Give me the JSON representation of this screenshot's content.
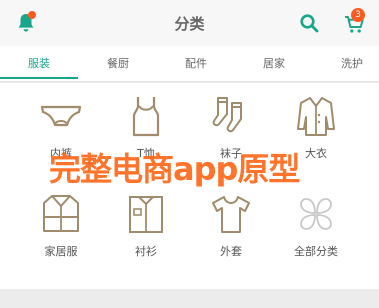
{
  "header": {
    "title": "分类",
    "cart_count": "3",
    "icons": {
      "notify": "bell-icon",
      "search": "search-icon",
      "cart": "cart-icon"
    },
    "colors": {
      "accent": "#1aa68a",
      "badge": "#ff5a1f"
    }
  },
  "tabs": [
    {
      "label": "服装",
      "active": true
    },
    {
      "label": "餐厨",
      "active": false
    },
    {
      "label": "配件",
      "active": false
    },
    {
      "label": "居家",
      "active": false
    },
    {
      "label": "洗护",
      "active": false
    }
  ],
  "categories": [
    {
      "label": "内裤",
      "icon": "underwear-icon"
    },
    {
      "label": "T恤",
      "icon": "tank-top-icon"
    },
    {
      "label": "袜子",
      "icon": "socks-icon"
    },
    {
      "label": "大衣",
      "icon": "coat-icon"
    },
    {
      "label": "家居服",
      "icon": "loungewear-icon"
    },
    {
      "label": "衬衫",
      "icon": "shirt-icon"
    },
    {
      "label": "外套",
      "icon": "tshirt-icon"
    },
    {
      "label": "全部分类",
      "icon": "clover-icon"
    }
  ],
  "watermark": "完整电商app原型"
}
